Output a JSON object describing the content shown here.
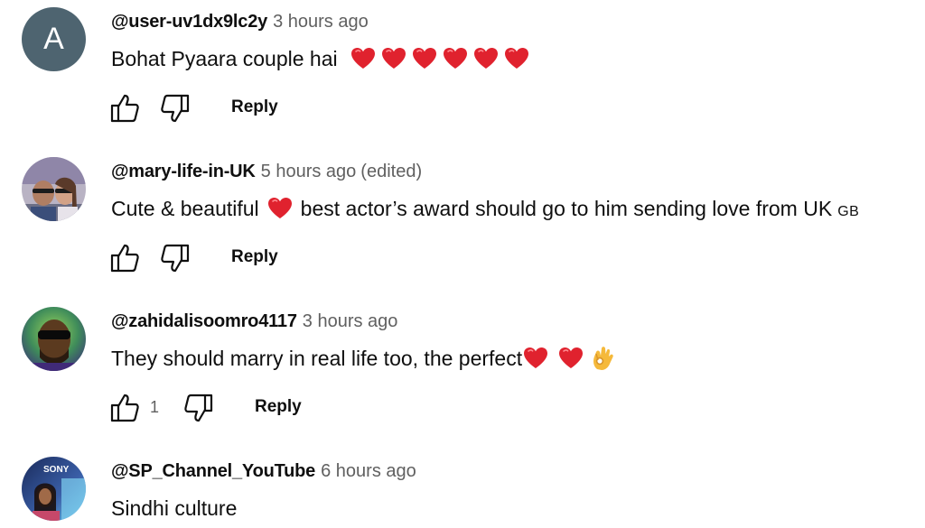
{
  "comments": [
    {
      "author": "@user-uv1dx9lc2y",
      "time": "3 hours ago",
      "edited": "",
      "avatar_letter": "A",
      "text": "Bohat Pyaara couple hai",
      "reply_label": "Reply",
      "like_count": "",
      "emojis": [
        "red-heart",
        "red-heart",
        "red-heart",
        "red-heart",
        "red-heart",
        "red-heart"
      ]
    },
    {
      "author": "@mary-life-in-UK",
      "time": "5 hours ago",
      "edited": "(edited)",
      "text_part1": "Cute & beautiful",
      "text_part2": "best actor’s award should go to him  sending love from UK",
      "flag_text": "GB",
      "reply_label": "Reply",
      "like_count": "",
      "emojis": [
        "red-heart"
      ]
    },
    {
      "author": "@zahidalisoomro4117",
      "time": "3 hours ago",
      "edited": "",
      "text": "They should marry in real life too,  the perfect",
      "reply_label": "Reply",
      "like_count": "1",
      "emojis": [
        "red-heart",
        "red-heart",
        "ok-hand"
      ]
    },
    {
      "author": "@SP_Channel_YouTube",
      "time": "6 hours ago",
      "edited": "",
      "text": "Sindhi culture",
      "avatar_text": "SONY"
    }
  ],
  "colors": {
    "text_primary": "#0f0f0f",
    "text_secondary": "#606060",
    "avatar_letter_bg": "#4e6470",
    "heart": "#e0222e"
  }
}
